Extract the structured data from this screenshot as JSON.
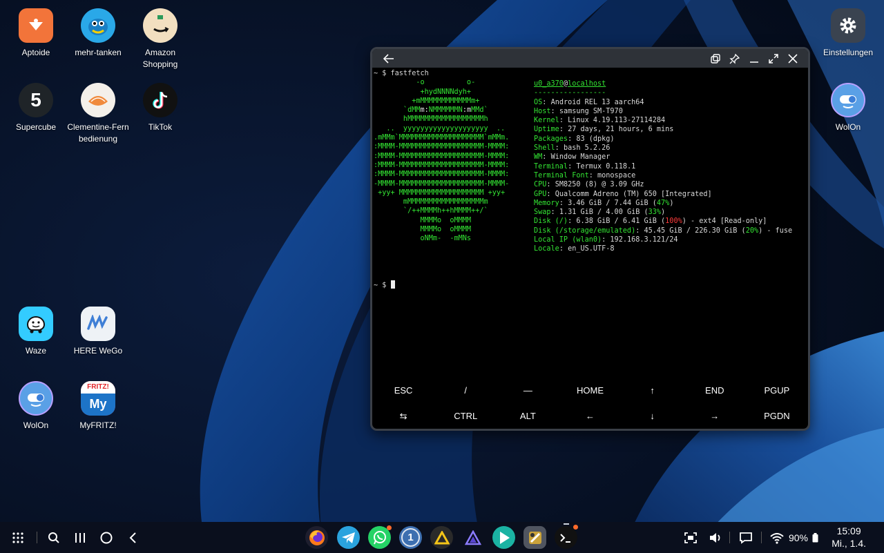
{
  "desktop": {
    "apps": [
      {
        "name": "aptoide",
        "label": "Aptoide"
      },
      {
        "name": "mehr-tanken",
        "label": "mehr-tanken"
      },
      {
        "name": "amazon-shopping",
        "label": "Amazon\nShopping"
      },
      {
        "name": "supercube",
        "label": "Supercube"
      },
      {
        "name": "clementine-fernbedienung",
        "label": "Clementine-Fern\nbedienung"
      },
      {
        "name": "tiktok",
        "label": "TikTok"
      },
      {
        "name": "waze",
        "label": "Waze"
      },
      {
        "name": "here-wego",
        "label": "HERE WeGo"
      },
      {
        "name": "wolon-left",
        "label": "WolOn"
      },
      {
        "name": "myfritz",
        "label": "MyFRITZ!"
      },
      {
        "name": "einstellungen",
        "label": "Einstellungen"
      },
      {
        "name": "wolon-right",
        "label": "WolOn"
      }
    ]
  },
  "terminal": {
    "command_line": "~ $ fastfetch",
    "user": "u0_a370",
    "host": "localhost",
    "separator": "-----------------",
    "info": [
      {
        "key": "OS",
        "value": "Android REL 13 aarch64"
      },
      {
        "key": "Host",
        "value": "samsung SM-T970"
      },
      {
        "key": "Kernel",
        "value": "Linux 4.19.113-27114284"
      },
      {
        "key": "Uptime",
        "value": "27 days, 21 hours, 6 mins"
      },
      {
        "key": "Packages",
        "value": "83 (dpkg)"
      },
      {
        "key": "Shell",
        "value": "bash 5.2.26"
      },
      {
        "key": "WM",
        "value": "Window Manager"
      },
      {
        "key": "Terminal",
        "value": "Termux 0.118.1"
      },
      {
        "key": "Terminal Font",
        "value": "monospace"
      },
      {
        "key": "CPU",
        "value": "SM8250 (8) @ 3.09 GHz"
      },
      {
        "key": "GPU",
        "value": "Qualcomm Adreno (TM) 650 [Integrated]"
      },
      {
        "key": "Memory",
        "value": "3.46 GiB / 7.44 GiB (",
        "pct": "47%",
        "pct_color": "#33e533",
        "tail": ")"
      },
      {
        "key": "Swap",
        "value": "1.31 GiB / 4.00 GiB (",
        "pct": "33%",
        "pct_color": "#33e533",
        "tail": ")"
      },
      {
        "key": "Disk (/)",
        "value": "6.38 GiB / 6.41 GiB (",
        "pct": "100%",
        "pct_color": "#ff3b3b",
        "tail": ") - ext4 [Read-only]"
      },
      {
        "key": "Disk (/storage/emulated)",
        "value": "45.45 GiB / 226.30 GiB (",
        "pct": "20%",
        "pct_color": "#33e533",
        "tail": ") - fuse"
      },
      {
        "key": "Local IP (wlan0)",
        "value": "192.168.3.121/24"
      },
      {
        "key": "Locale",
        "value": "en_US.UTF-8"
      }
    ],
    "prompt": "~ $ ",
    "extra_keys": [
      [
        "ESC",
        "/",
        "—",
        "HOME",
        "↑",
        "END",
        "PGUP"
      ],
      [
        "⇆",
        "CTRL",
        "ALT",
        "←",
        "↓",
        "→",
        "PGDN"
      ]
    ]
  },
  "status": {
    "battery": "90%",
    "time": "15:09",
    "date": "Mi., 1.4."
  },
  "colors": {
    "terminal_green": "#33e533",
    "danger_red": "#ff3b3b",
    "notification_badge": "#ff6a2b"
  }
}
